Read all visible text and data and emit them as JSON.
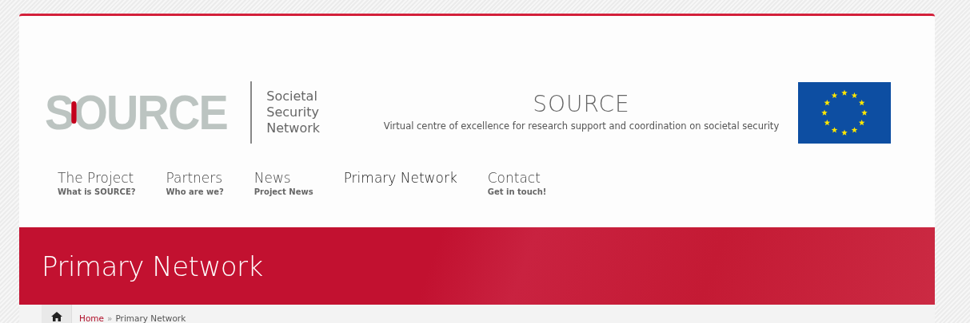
{
  "logo": {
    "wordmark": "SOURCE",
    "tagline": [
      "Societal",
      "Security",
      "Network"
    ]
  },
  "site": {
    "title": "SOURCE",
    "subtitle": "Virtual centre of excellence for research support and coordination on societal security"
  },
  "nav": [
    {
      "label": "The Project",
      "sub": "What is SOURCE?",
      "selected": false
    },
    {
      "label": "Partners",
      "sub": "Who are we?",
      "selected": false
    },
    {
      "label": "News",
      "sub": "Project News",
      "selected": false
    },
    {
      "label": "Primary Network",
      "selected": true
    },
    {
      "label": "Contact",
      "sub": "Get in touch!",
      "selected": false
    }
  ],
  "banner": {
    "title": "Primary Network"
  },
  "breadcrumb": {
    "link": "Home",
    "separator": "»",
    "current": "Primary Network"
  }
}
